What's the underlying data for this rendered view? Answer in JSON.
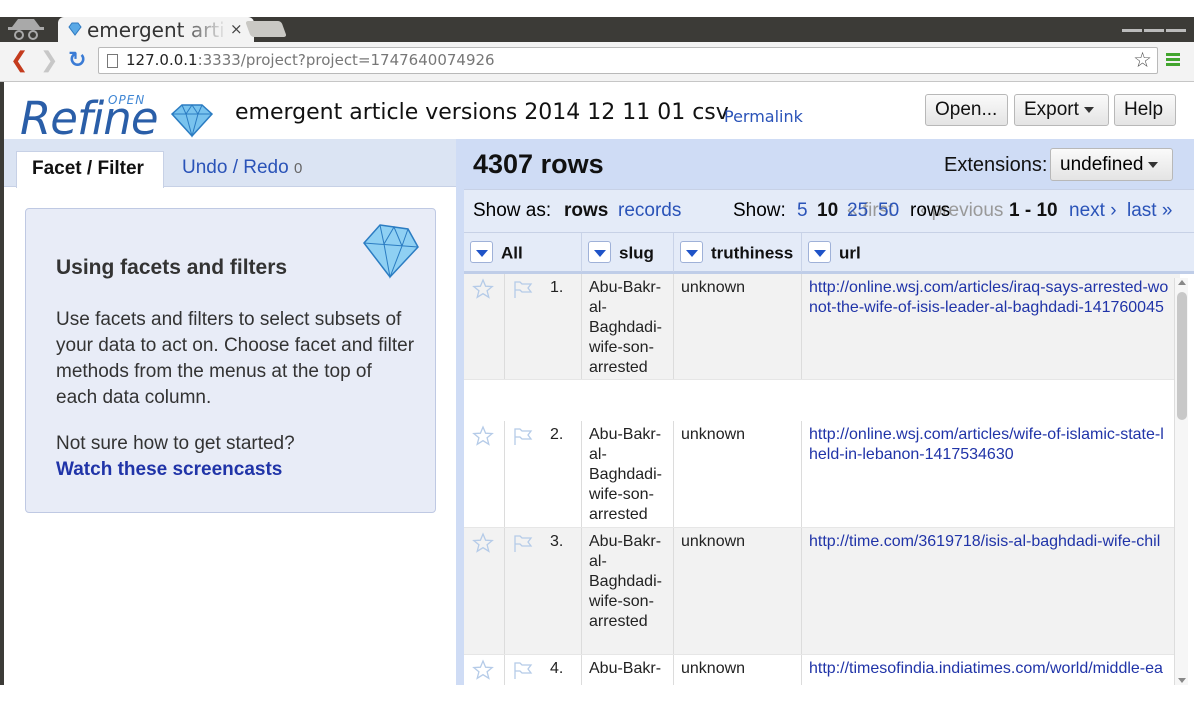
{
  "browser": {
    "tab_title": "emergent arti",
    "tab_close": "×",
    "url_host": "127.0.0.1",
    "url_rest": ":3333/project?project=1747640074926"
  },
  "header": {
    "logo_text": "Refine",
    "logo_open": "OPEN",
    "project_name": "emergent article versions 2014 12 11 01 csv",
    "permalink": "Permalink",
    "open_label": "Open...",
    "export_label": "Export",
    "help_label": "Help"
  },
  "left_panel": {
    "tab_facet": "Facet / Filter",
    "tab_undo": "Undo / Redo",
    "undo_count": "0",
    "help_title": "Using facets and filters",
    "help_body": "Use facets and filters to select subsets of your data to act on. Choose facet and filter methods from the menus at the top of each data column.",
    "help_question": "Not sure how to get started?",
    "help_link": "Watch these screencasts"
  },
  "right_panel": {
    "row_count": "4307 rows",
    "extensions_label": "Extensions:",
    "extensions_value": "undefined",
    "show_as_label": "Show as:",
    "show_as_rows": "rows",
    "show_as_records": "records",
    "show_label": "Show:",
    "page_sizes": [
      "5",
      "10",
      "25",
      "50"
    ],
    "rows_word": "rows",
    "first_label": "« first",
    "previous_label": "‹ previous",
    "range": "1 - 10",
    "next_label": "next ›",
    "last_label": "last »"
  },
  "grid": {
    "columns": [
      "All",
      "slug",
      "truthiness",
      "url"
    ],
    "rows": [
      {
        "num": "1.",
        "slug": [
          "Abu-Bakr-",
          "al-",
          "Baghdadi-",
          "wife-son-",
          "arrested"
        ],
        "truthiness": "unknown",
        "url": [
          "http://online.wsj.com/articles/iraq-says-arrested-wo",
          "not-the-wife-of-isis-leader-al-baghdadi-141760045"
        ]
      },
      {
        "num": "2.",
        "slug": [
          "Abu-Bakr-",
          "al-",
          "Baghdadi-",
          "wife-son-",
          "arrested"
        ],
        "truthiness": "unknown",
        "url": [
          "http://online.wsj.com/articles/wife-of-islamic-state-l",
          "held-in-lebanon-1417534630"
        ]
      },
      {
        "num": "3.",
        "slug": [
          "Abu-Bakr-",
          "al-",
          "Baghdadi-",
          "wife-son-",
          "arrested"
        ],
        "truthiness": "unknown",
        "url": [
          "http://time.com/3619718/isis-al-baghdadi-wife-chil"
        ]
      },
      {
        "num": "4.",
        "slug": [
          "Abu-Bakr-"
        ],
        "truthiness": "unknown",
        "url": [
          "http://timesofindia.indiatimes.com/world/middle-ea"
        ]
      }
    ]
  },
  "colors": {
    "link": "#2a53b8",
    "panel_bg": "#cfdcf5",
    "logo_blue": "#2a5ea8"
  }
}
